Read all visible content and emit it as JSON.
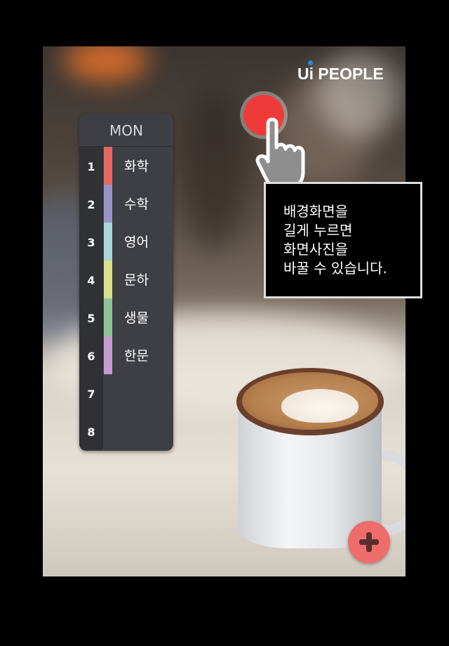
{
  "brand": {
    "logo_text": "Ui PEOPLE",
    "logo_dot_color": "#1e8ee8"
  },
  "timetable": {
    "day": "MON",
    "periods": [
      {
        "num": "1",
        "subject": "화학",
        "color": "#e8675f"
      },
      {
        "num": "2",
        "subject": "수학",
        "color": "#9b93c8"
      },
      {
        "num": "3",
        "subject": "영어",
        "color": "#a8d9d6"
      },
      {
        "num": "4",
        "subject": "문하",
        "color": "#d7e08a"
      },
      {
        "num": "5",
        "subject": "생물",
        "color": "#8fc49a"
      },
      {
        "num": "6",
        "subject": "한문",
        "color": "#c59bd0"
      },
      {
        "num": "7",
        "subject": "",
        "color": ""
      },
      {
        "num": "8",
        "subject": "",
        "color": ""
      }
    ]
  },
  "tutorial": {
    "tooltip_text": "배경화면을\n길게 누르면\n화면사진을\n바꿀 수 있습니다.",
    "touch_color": "#ef3a3a"
  },
  "actions": {
    "add_button_icon": "plus-icon",
    "add_button_color": "#ee6c6a"
  }
}
